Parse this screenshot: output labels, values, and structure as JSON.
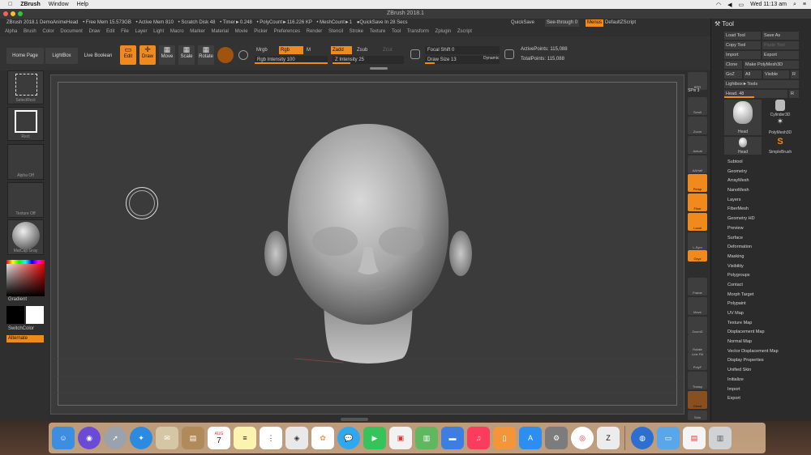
{
  "menubar": {
    "app_name": "ZBrush",
    "items": [
      "Window",
      "Help"
    ],
    "clock": "Wed 11:13 am",
    "accent": "#2b6de8"
  },
  "window": {
    "title": "ZBrush 2018.1"
  },
  "infobar": {
    "doc": "ZBrush 2018.1 DemoAnimeHead",
    "free_mem": "• Free Mem 15.573GB",
    "active_mem": "• Active Mem 810",
    "scratch": "• Scratch Disk 48",
    "timer": "• Timer►0.248",
    "polycount": "• PolyCount►116.226 KP",
    "meshcount": "• MeshCount►1",
    "quicksave_in": "●QuickSave In 28 Secs",
    "quicksave": "QuickSave",
    "see_through": "See-through",
    "see_through_value": "0",
    "menus": "Menus",
    "default_zscript": "DefaultZScript"
  },
  "menus": [
    "Alpha",
    "Brush",
    "Color",
    "Document",
    "Draw",
    "Edit",
    "File",
    "Layer",
    "Light",
    "Macro",
    "Marker",
    "Material",
    "Movie",
    "Picker",
    "Preferences",
    "Render",
    "Stencil",
    "Stroke",
    "Texture",
    "Tool",
    "Transform",
    "Zplugin",
    "Zscript"
  ],
  "toolbar": {
    "home_page": "Home Page",
    "lightbox": "LightBox",
    "live_boolean": "Live Boolean",
    "edit": "Edit",
    "draw": "Draw",
    "move": "Move",
    "scale": "Scale",
    "rotate": "Rotate",
    "mrgb": "Mrgb",
    "rgb": "Rgb",
    "m": "M",
    "rgb_intensity": "Rgb Intensity 100",
    "zadd": "Zadd",
    "zsub": "Zsub",
    "zcut": "Zcut",
    "z_intensity": "Z Intensity 25",
    "focal_shift": "Focal Shift 0",
    "draw_size": "Draw Size 13",
    "dynamic": "Dynamic",
    "active_points": "ActivePoints: 115,088",
    "total_points": "TotalPoints: 115,088"
  },
  "left": {
    "select_rect": "SelectRect",
    "rect": "Rect",
    "alpha_off": "Alpha Off",
    "texture_off": "Texture Off",
    "matcap": "MatCap Gray",
    "gradient": "Gradient",
    "switch_color": "SwitchColor",
    "alternate": "Alternate"
  },
  "shelf": [
    "BPR",
    "SPix 3",
    "Scroll",
    "Zoom",
    "Actual",
    "AAHalf",
    "Persp",
    "Floor",
    "Local",
    "L.Sym",
    "Gxyz",
    "Frame",
    "Move",
    "ZoomD",
    "Rotate",
    "Line Fill",
    "PolyF",
    "Transp",
    "Ghost",
    "Solo"
  ],
  "tool": {
    "title": "Tool",
    "load_tool": "Load Tool",
    "save_as": "Save As",
    "copy_tool": "Copy Tool",
    "paste_tool": "Paste Tool",
    "import": "Import",
    "export": "Export",
    "clone": "Clone",
    "make_polymesh": "Make PolyMesh3D",
    "goz": "GoZ",
    "all": "All",
    "visible": "Visible",
    "r": "R",
    "lightbox_tools": "Lightbox►Tools",
    "head_slider": "Head. 48",
    "thumbs": [
      "Head",
      "Cylinder3D",
      "PolyMesh3D",
      "Head",
      "SimpleBrush"
    ],
    "sections": [
      "Subtool",
      "Geometry",
      "ArrayMesh",
      "NanoMesh",
      "Layers",
      "FiberMesh",
      "Geometry HD",
      "Preview",
      "Surface",
      "Deformation",
      "Masking",
      "Visibility",
      "Polygroups",
      "Contact",
      "Morph Target",
      "Polypaint",
      "UV Map",
      "Texture Map",
      "Displacement Map",
      "Normal Map",
      "Vector Displacement Map",
      "Display Properties",
      "Unified Skin",
      "Initialize",
      "Import",
      "Export"
    ]
  },
  "dock": {
    "calendar_month": "AUG",
    "calendar_day": "7"
  }
}
